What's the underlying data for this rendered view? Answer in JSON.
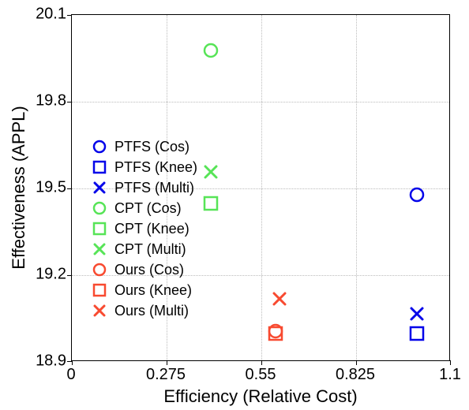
{
  "chart_data": {
    "type": "scatter",
    "xlabel": "Efficiency (Relative Cost)",
    "ylabel": "Effectiveness (APPL)",
    "xlim": [
      0,
      1.1
    ],
    "ylim": [
      18.9,
      20.1
    ],
    "xticks": [
      0,
      0.275,
      0.55,
      0.825,
      1.1
    ],
    "yticks": [
      18.9,
      19.2,
      19.5,
      19.8,
      20.1
    ],
    "series": [
      {
        "name": "PTFS (Cos)",
        "color": "#0404e9",
        "marker": "circle",
        "x": [
          1.0
        ],
        "y": [
          19.48
        ]
      },
      {
        "name": "PTFS (Knee)",
        "color": "#0404e9",
        "marker": "square",
        "x": [
          1.0
        ],
        "y": [
          19.0
        ]
      },
      {
        "name": "PTFS (Multi)",
        "color": "#0404e9",
        "marker": "x",
        "x": [
          1.0
        ],
        "y": [
          19.07
        ]
      },
      {
        "name": "CPT (Cos)",
        "color": "#57e457",
        "marker": "circle",
        "x": [
          0.4
        ],
        "y": [
          19.98
        ]
      },
      {
        "name": "CPT (Knee)",
        "color": "#57e457",
        "marker": "square",
        "x": [
          0.4
        ],
        "y": [
          19.45
        ]
      },
      {
        "name": "CPT (Multi)",
        "color": "#57e457",
        "marker": "x",
        "x": [
          0.4
        ],
        "y": [
          19.56
        ]
      },
      {
        "name": "Ours (Cos)",
        "color": "#f84a30",
        "marker": "circle",
        "x": [
          0.59
        ],
        "y": [
          19.01
        ]
      },
      {
        "name": "Ours (Knee)",
        "color": "#f84a30",
        "marker": "square",
        "x": [
          0.59
        ],
        "y": [
          19.0
        ]
      },
      {
        "name": "Ours (Multi)",
        "color": "#f84a30",
        "marker": "x",
        "x": [
          0.6
        ],
        "y": [
          19.12
        ]
      }
    ],
    "xtick_labels": [
      "0",
      "0.275",
      "0.55",
      "0.825",
      "1.1"
    ],
    "ytick_labels": [
      "18.9",
      "19.2",
      "19.5",
      "19.8",
      "20.1"
    ]
  },
  "legend": {
    "entries": [
      "PTFS (Cos)",
      "PTFS (Knee)",
      "PTFS (Multi)",
      "CPT (Cos)",
      "CPT (Knee)",
      "CPT (Multi)",
      "Ours (Cos)",
      "Ours (Knee)",
      "Ours (Multi)"
    ]
  }
}
